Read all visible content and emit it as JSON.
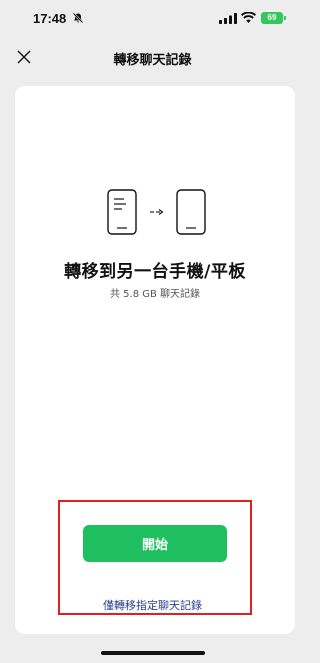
{
  "status": {
    "time": "17:48",
    "battery": "69"
  },
  "nav": {
    "title": "轉移聊天記錄"
  },
  "content": {
    "headline": "轉移到另一台手機/平板",
    "subline": "共 5.8 GB 聊天記錄"
  },
  "actions": {
    "start_label": "開始",
    "specific_label": "僅轉移指定聊天記錄"
  },
  "colors": {
    "accent": "#1fbf5f",
    "link": "#2a3f8c",
    "highlight": "#e02020"
  },
  "icons": [
    "bell-slash-icon",
    "cellular-signal-icon",
    "wifi-icon",
    "battery-icon",
    "close-icon",
    "phone-transfer-icon"
  ]
}
